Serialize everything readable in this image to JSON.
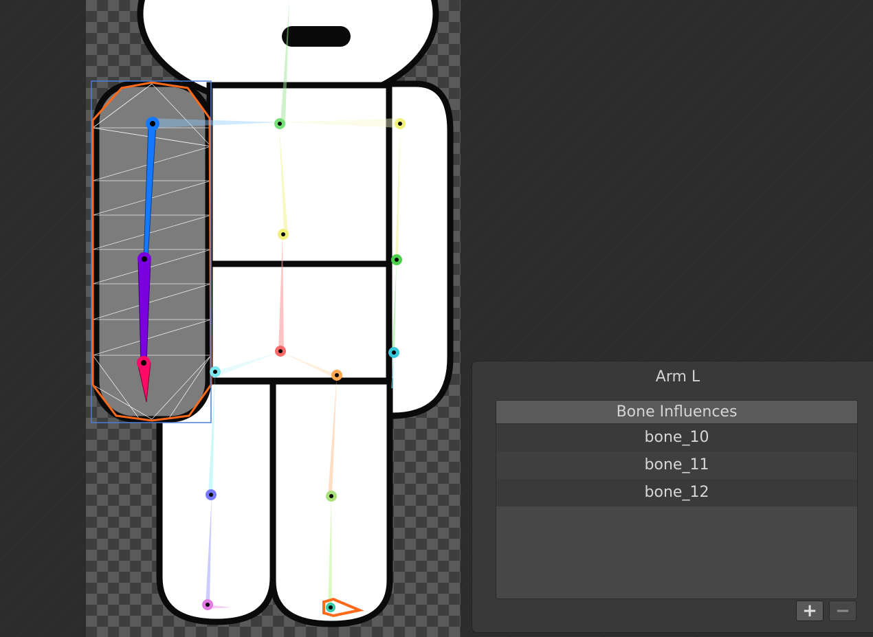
{
  "inspector": {
    "title": "Arm L",
    "list_header": "Bone Influences",
    "bones": [
      "bone_10",
      "bone_11",
      "bone_12"
    ],
    "add_label": "+",
    "remove_label": "−"
  },
  "colors": {
    "selection_outline": "#ff6a1a",
    "bounds_rect": "#4a7fd6",
    "bone_10": "#1479ff",
    "bone_11": "#7a00e0",
    "bone_12": "#ff0a68"
  },
  "icons": [
    "plus-icon",
    "minus-icon"
  ]
}
